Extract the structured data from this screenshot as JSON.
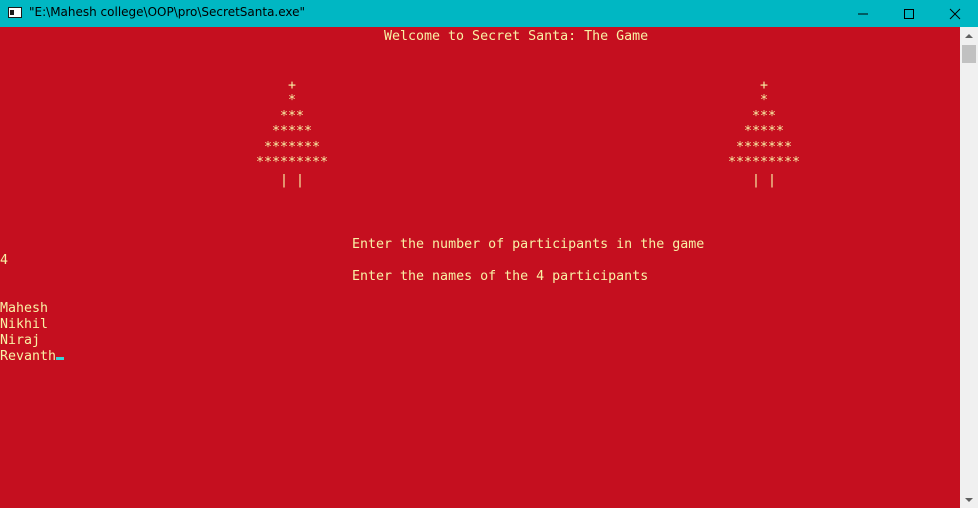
{
  "window": {
    "title": "\"E:\\Mahesh college\\OOP\\pro\\SecretSanta.exe\"",
    "titlebar_color": "#00b7c3",
    "console_bg": "#c50f1f",
    "console_fg": "#f9f1a5",
    "icons": [
      "console-app-icon",
      "minimize-icon",
      "maximize-icon",
      "close-icon"
    ]
  },
  "console": {
    "welcome": "Welcome to Secret Santa: The Game",
    "tree_left": [
      "+",
      "*",
      "***",
      "*****",
      "*******",
      "*********",
      "| |"
    ],
    "tree_right": [
      "+",
      "*",
      "***",
      "*****",
      "*******",
      "*********",
      "| |"
    ],
    "prompt_count": "Enter the number of participants in the game",
    "count_value": "4",
    "prompt_names": "Enter the names of the 4 participants",
    "names": [
      "Mahesh",
      "Nikhil",
      "Niraj",
      "Revanth"
    ]
  }
}
